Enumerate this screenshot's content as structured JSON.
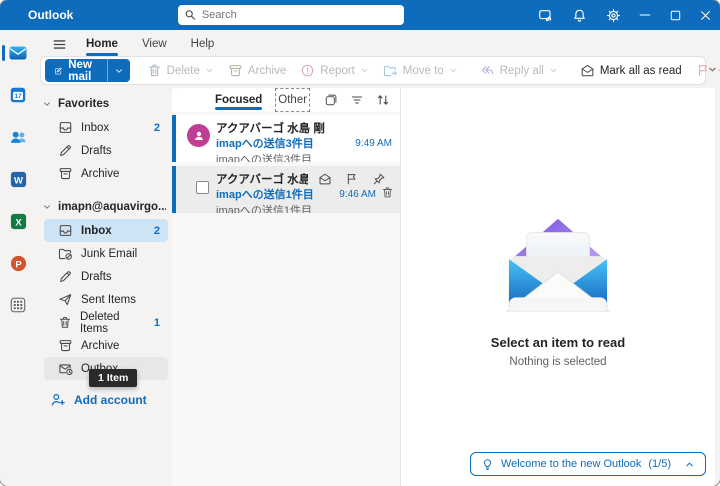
{
  "titlebar": {
    "app_name": "Outlook",
    "search_placeholder": "Search",
    "icons": [
      "feedback-icon",
      "notifications-icon",
      "settings-icon",
      "minimize-icon",
      "maximize-icon",
      "close-icon"
    ]
  },
  "menubar": {
    "tabs": [
      {
        "label": "Home",
        "active": true
      },
      {
        "label": "View",
        "active": false
      },
      {
        "label": "Help",
        "active": false
      }
    ]
  },
  "toolbar": {
    "new_mail": "New mail",
    "delete": "Delete",
    "archive": "Archive",
    "report": "Report",
    "move_to": "Move to",
    "reply_all": "Reply all",
    "mark_all_as_read": "Mark all as read",
    "icons": [
      "compose-icon",
      "trash-icon",
      "archive-icon",
      "report-icon",
      "move-folder-icon",
      "reply-all-icon",
      "mail-read-icon",
      "flag-icon",
      "settings-icon",
      "undo-icon",
      "ellipsis-icon",
      "chevron-down-icon"
    ]
  },
  "app_rail": {
    "items": [
      "mail",
      "calendar",
      "people",
      "word",
      "excel",
      "powerpoint",
      "more-apps"
    ],
    "active": "mail"
  },
  "folder_pane": {
    "favorites_header": "Favorites",
    "favorites": [
      {
        "label": "Inbox",
        "count": "2"
      },
      {
        "label": "Drafts",
        "count": ""
      },
      {
        "label": "Archive",
        "count": ""
      }
    ],
    "account_header": "imapn@aquavirgo....",
    "account_folders": [
      {
        "label": "Inbox",
        "count": "2"
      },
      {
        "label": "Junk Email",
        "count": ""
      },
      {
        "label": "Drafts",
        "count": ""
      },
      {
        "label": "Sent Items",
        "count": ""
      },
      {
        "label": "Deleted Items",
        "count": "1"
      },
      {
        "label": "Archive",
        "count": ""
      },
      {
        "label": "Outbox",
        "count": ""
      }
    ],
    "outbox_tooltip": "1 Item",
    "add_account": "Add account"
  },
  "message_list": {
    "tab_focused": "Focused",
    "tab_other": "Other",
    "messages": [
      {
        "sender": "アクアバーゴ 水島 剛",
        "subject": "imapへの送信3件目",
        "preview": "imapへの送信3件目",
        "time": "9:49 AM"
      },
      {
        "sender": "アクアバーゴ 水島...",
        "subject": "imapへの送信1件目",
        "preview": "imapへの送信1件目",
        "time": "9:46 AM"
      }
    ]
  },
  "reading_pane": {
    "empty_title": "Select an item to read",
    "empty_subtitle": "Nothing is selected"
  },
  "callout": {
    "label": "Welcome to the new Outlook",
    "progress": "(1/5)"
  },
  "colors": {
    "accent": "#0f6cbd",
    "titlebar_bg": "#0f6cbd",
    "avatar": "#bf3d92",
    "selected_folder_bg": "#cde4f7",
    "tooltip_bg": "#2b2a28",
    "unread_bar": "#0f6cbd"
  }
}
